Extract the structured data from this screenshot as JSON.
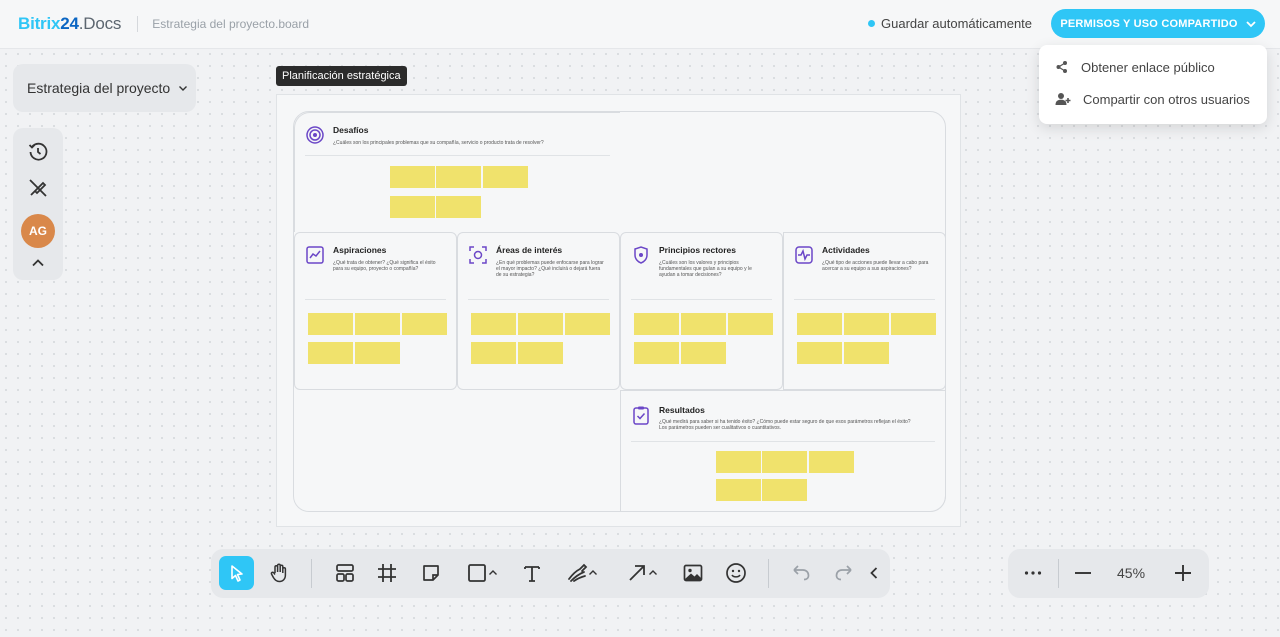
{
  "header": {
    "logo_main": "Bitrix",
    "logo_num": "24",
    "logo_docs": ".Docs",
    "filename": "Estrategia del proyecto.board",
    "autosave_label": "Guardar automáticamente",
    "share_button_label": "PERMISOS Y USO COMPARTIDO"
  },
  "share_menu": {
    "items": [
      {
        "label": "Obtener enlace público",
        "icon": "share-icon"
      },
      {
        "label": "Compartir con otros usuarios",
        "icon": "add-user-icon"
      }
    ]
  },
  "sidebar": {
    "project_label": "Estrategia del proyecto",
    "avatar_initials": "AG"
  },
  "board": {
    "frame_label": "Planificación estratégica",
    "cards": [
      {
        "title": "Desafíos",
        "desc": "¿Cuáles son los principales problemas que su compañía, servicio o producto trata de resolver?"
      },
      {
        "title": "Aspiraciones",
        "desc": "¿Qué trata de obtener? ¿Qué significa el éxito para su equipo, proyecto o compañía?"
      },
      {
        "title": "Áreas de interés",
        "desc": "¿En qué problemas puede enfocarse para lograr el mayor impacto? ¿Qué incluirá o dejará fuera de su estrategia?"
      },
      {
        "title": "Principios rectores",
        "desc": "¿Cuáles son los valores y principios fundamentales que guían a su equipo y le ayudan a tomar decisiones?"
      },
      {
        "title": "Actividades",
        "desc": "¿Qué tipo de acciones puede llevar a cabo para acercar a su equipo a sus aspiraciones?"
      },
      {
        "title": "Resultados",
        "desc": "¿Qué medirá para saber si ha tenido éxito? ¿Cómo puede estar seguro de que esos parámetros reflejan el éxito? Los parámetros pueden ser cualitativos o cuantitativos."
      }
    ]
  },
  "zoom": {
    "value": "45%"
  },
  "colors": {
    "accent": "#2fc6f6",
    "sticky_note": "#f0e26c",
    "avatar": "#d9884a"
  }
}
